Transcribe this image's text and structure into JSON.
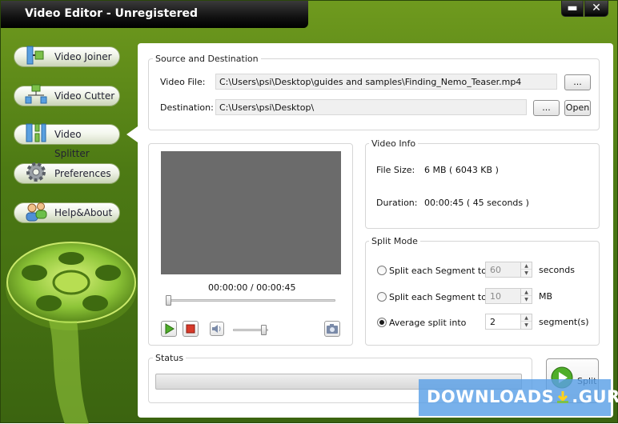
{
  "window": {
    "title": "Video Editor - Unregistered",
    "minimize_glyph": "▬",
    "close_glyph": "✕"
  },
  "sidebar": {
    "items": [
      {
        "label": "Video Joiner",
        "icon": "joiner-icon"
      },
      {
        "label": "Video Cutter",
        "icon": "cutter-icon"
      },
      {
        "label": "Video Splitter",
        "icon": "splitter-icon"
      },
      {
        "label": "Preferences",
        "icon": "gear-icon"
      },
      {
        "label": "Help&About",
        "icon": "people-icon"
      }
    ],
    "active": "Video Splitter"
  },
  "source": {
    "group_title": "Source and Destination",
    "video_file_label": "Video File:",
    "video_file_value": "C:\\Users\\psi\\Desktop\\guides and samples\\Finding_Nemo_Teaser.mp4",
    "browse_label": "...",
    "destination_label": "Destination:",
    "destination_value": "C:\\Users\\psi\\Desktop\\",
    "dest_browse_label": "...",
    "open_label": "Open"
  },
  "player": {
    "time": "00:00:00 / 00:00:45",
    "seek_fraction": 0.0,
    "volume_fraction": 0.95
  },
  "video_info": {
    "group_title": "Video Info",
    "file_size_label": "File Size:",
    "file_size_value": "6 MB ( 6043 KB )",
    "duration_label": "Duration:",
    "duration_value": "00:00:45 ( 45 seconds )"
  },
  "split_mode": {
    "group_title": "Split Mode",
    "options": [
      {
        "label": "Split each Segment to",
        "value": "60",
        "unit": "seconds",
        "checked": false
      },
      {
        "label": "Split each Segment to",
        "value": "10",
        "unit": "MB",
        "checked": false
      },
      {
        "label": "Average split into",
        "value": "2",
        "unit": "segment(s)",
        "checked": true
      }
    ]
  },
  "status": {
    "group_title": "Status",
    "progress_fraction": 0.0
  },
  "split_button": {
    "label": "Split"
  },
  "watermark": {
    "text": "DOWNLOADS",
    "suffix": ".GURU"
  },
  "colors": {
    "accent_green": "#5a8a18",
    "watermark_blue": "#5aa0e6"
  }
}
